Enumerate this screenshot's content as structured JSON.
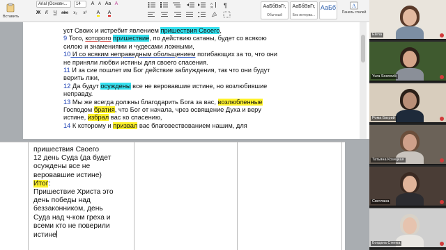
{
  "ribbon": {
    "paste_label": "Вставить",
    "font_name": "Arial (Основн...",
    "font_size": "14",
    "style_normal_sample": "АаБбВвГг,",
    "style_normal_label": "Обычный",
    "style_nospacing_sample": "АаБбВвГг,",
    "style_nospacing_label": "Без интерва...",
    "style_heading_sample": "АаБб",
    "styles_pane_label": "Панель стилей",
    "format_buttons": [
      "Ж",
      "К",
      "Ч",
      "abc",
      "x₂",
      "x²"
    ],
    "color_letters": [
      "A",
      "A"
    ]
  },
  "document_upper": {
    "lines": [
      {
        "num": "",
        "parts": [
          {
            "t": "уст Своих и истребит явлением "
          },
          {
            "t": "пришествия Своего",
            "hl": "cyan"
          },
          {
            "t": ","
          }
        ]
      },
      {
        "num": "9",
        "parts": [
          {
            "t": " Того, "
          },
          {
            "t": "которого",
            "u": "red"
          },
          {
            "t": " "
          },
          {
            "t": "пришествие",
            "hl": "cyan"
          },
          {
            "t": ", по действию сатаны, будет со всякою"
          }
        ]
      },
      {
        "num": "",
        "parts": [
          {
            "t": "силою и знамениями и чудесами ложными,"
          }
        ]
      },
      {
        "num": "10",
        "parts": [
          {
            "t": " И со всяким неправедным обольщением",
            "u": "blue"
          },
          {
            "t": " погибающих за то, что они"
          }
        ]
      },
      {
        "num": "",
        "parts": [
          {
            "t": "не приняли любви истины для своего спасения."
          }
        ]
      },
      {
        "num": "11",
        "parts": [
          {
            "t": " И за сие пошлет им Бог действие заблуждения, так что они будут"
          }
        ]
      },
      {
        "num": "",
        "parts": [
          {
            "t": "верить лжи,"
          }
        ]
      },
      {
        "num": "12",
        "parts": [
          {
            "t": " Да будут "
          },
          {
            "t": "осуждены",
            "hl": "cyan"
          },
          {
            "t": " все не веровавшие истине, но возлюбившие"
          }
        ]
      },
      {
        "num": "",
        "parts": [
          {
            "t": "неправду."
          }
        ]
      },
      {
        "num": "13",
        "parts": [
          {
            "t": " Мы же всегда должны благодарить Бога за вас, "
          },
          {
            "t": "возлюбленные",
            "hl": "yellow"
          }
        ]
      },
      {
        "num": "",
        "parts": [
          {
            "t": "Господом "
          },
          {
            "t": "братия",
            "hl": "yellow"
          },
          {
            "t": ", что Бог от начала, чрез освящение Духа и веру"
          }
        ]
      },
      {
        "num": "",
        "parts": [
          {
            "t": "истине, "
          },
          {
            "t": "избрал",
            "hl": "yellow"
          },
          {
            "t": " вас ко спасению,"
          }
        ]
      },
      {
        "num": "14",
        "parts": [
          {
            "t": " К которому и "
          },
          {
            "t": "призвал",
            "hl": "yellow"
          },
          {
            "t": " вас благовествованием нашим, для"
          }
        ]
      }
    ]
  },
  "document_lower": {
    "lines": [
      {
        "parts": [
          {
            "t": "   пришествия Своего"
          }
        ]
      },
      {
        "parts": [
          {
            "t": "12 день Суда (да будет"
          }
        ]
      },
      {
        "parts": [
          {
            "t": "   осуждены все не"
          }
        ]
      },
      {
        "parts": [
          {
            "t": "   веровавшие истине)"
          }
        ]
      },
      {
        "parts": [
          {
            "t": "Итог",
            "hl": "yellow"
          },
          {
            "t": ":"
          }
        ]
      },
      {
        "parts": [
          {
            "t": "Пришествие Христа это"
          }
        ]
      },
      {
        "parts": [
          {
            "t": "   день победы над"
          }
        ]
      },
      {
        "parts": [
          {
            "t": "   беззаконником, день"
          }
        ]
      },
      {
        "parts": [
          {
            "t": "   Суда над ч-ком греха и"
          }
        ]
      },
      {
        "parts": [
          {
            "t": "   всеми кто не поверили"
          }
        ]
      },
      {
        "parts": [
          {
            "t": "   истине"
          }
        ]
      }
    ]
  },
  "participants": [
    {
      "name": "Elena",
      "bg": "#e9e4dc",
      "skin": "#e3b9a0",
      "hair": "#5a3a2a",
      "shirt": "#7c8ea3"
    },
    {
      "name": "Yura Sosnovik",
      "bg": "#3f5a2f",
      "skin": "#d6a58a",
      "hair": "#2d2018",
      "shirt": "#8a8f98"
    },
    {
      "name": "Рома Багрий",
      "bg": "#d8cdbd",
      "skin": "#b98f78",
      "hair": "#2a1f18",
      "shirt": "#1e2a3a"
    },
    {
      "name": "Татьяна Козицкая",
      "bg": "#6b6258",
      "skin": "#cfa08a",
      "hair": "#6b4e3b",
      "shirt": "#c9c4be"
    },
    {
      "name": "Светлана",
      "bg": "#4a3d36",
      "skin": "#e1b49a",
      "hair": "#3b2a22",
      "shirt": "#2c2c30"
    },
    {
      "name": "Богдана Степка",
      "bg": "#cfcfcf",
      "skin": "#e6c3ae",
      "hair": "#d8d2c8",
      "shirt": "#e8e6e2"
    }
  ]
}
